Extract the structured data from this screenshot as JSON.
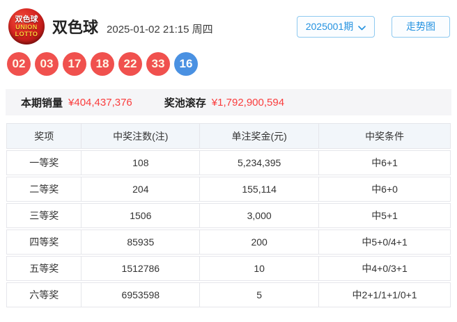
{
  "header": {
    "logo_line1": "双色球",
    "logo_line2": "UNION",
    "logo_line3": "LOTTO",
    "title": "双色球",
    "datetime": "2025-01-02 21:15 周四",
    "issue_label": "2025001期",
    "trend_button": "走势图"
  },
  "draw": {
    "red_balls": [
      "02",
      "03",
      "17",
      "18",
      "22",
      "33"
    ],
    "blue_ball": "16",
    "red_color": "#f0514e",
    "blue_color": "#4a91e2"
  },
  "stats": {
    "sales_label": "本期销量",
    "sales_value": "¥404,437,376",
    "pool_label": "奖池滚存",
    "pool_value": "¥1,792,900,594",
    "value_color": "#fa3d3d"
  },
  "prize_table": {
    "headers": [
      "奖项",
      "中奖注数(注)",
      "单注奖金(元)",
      "中奖条件"
    ],
    "rows": [
      [
        "一等奖",
        "108",
        "5,234,395",
        "中6+1"
      ],
      [
        "二等奖",
        "204",
        "155,114",
        "中6+0"
      ],
      [
        "三等奖",
        "1506",
        "3,000",
        "中5+1"
      ],
      [
        "四等奖",
        "85935",
        "200",
        "中5+0/4+1"
      ],
      [
        "五等奖",
        "1512786",
        "10",
        "中4+0/3+1"
      ],
      [
        "六等奖",
        "6953598",
        "5",
        "中2+1/1+1/0+1"
      ]
    ]
  }
}
